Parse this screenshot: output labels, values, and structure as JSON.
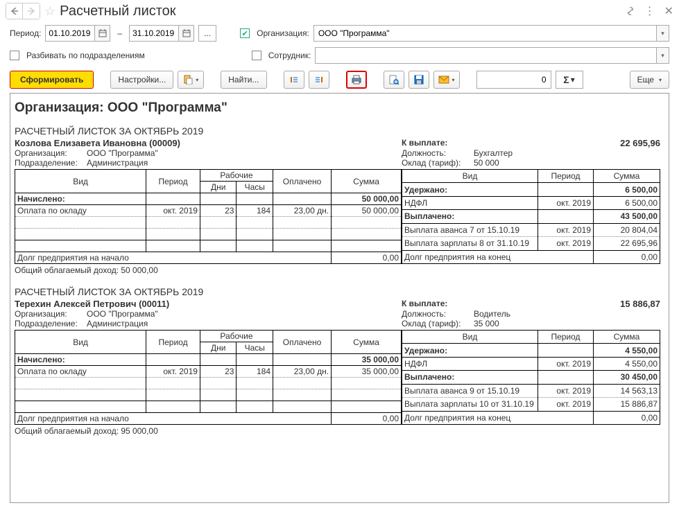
{
  "title": "Расчетный листок",
  "period": {
    "label": "Период:",
    "from": "01.10.2019",
    "to": "31.10.2019",
    "dash": "–"
  },
  "org_filter": {
    "checked": true,
    "label": "Организация:",
    "value": "ООО \"Программа\""
  },
  "split_depts": {
    "checked": false,
    "label": "Разбивать по подразделениям"
  },
  "employee_filter": {
    "checked": false,
    "label": "Сотрудник:",
    "value": ""
  },
  "toolbar": {
    "form": "Сформировать",
    "settings": "Настройки...",
    "find": "Найти...",
    "num_value": "0",
    "more": "Еще"
  },
  "report": {
    "org_header": "Организация: ООО \"Программа\"",
    "headers": {
      "vid": "Вид",
      "period": "Период",
      "work": "Рабочие",
      "days": "Дни",
      "hours": "Часы",
      "paid": "Оплачено",
      "sum": "Сумма",
      "accrued": "Начислено:",
      "withheld": "Удержано:",
      "paid_out": "Выплачено:",
      "debt_start": "Долг предприятия на начало",
      "debt_end": "Долг предприятия на конец",
      "tax_income": "Общий облагаемый доход:"
    },
    "slips": [
      {
        "title": "РАСЧЕТНЫЙ ЛИСТОК ЗА ОКТЯБРЬ 2019",
        "name": "Козлова Елизавета Ивановна (00009)",
        "to_pay_label": "К выплате:",
        "to_pay": "22 695,96",
        "org_label": "Организация:",
        "org": "ООО \"Программа\"",
        "pos_label": "Должность:",
        "pos": "Бухгалтер",
        "dept_label": "Подразделение:",
        "dept": "Администрация",
        "salary_label": "Оклад (тариф):",
        "salary": "50 000",
        "accrued_total": "50 000,00",
        "withheld_total": "6 500,00",
        "paidout_total": "43 500,00",
        "accrued_rows": [
          {
            "vid": "Оплата по окладу",
            "period": "окт. 2019",
            "days": "23",
            "hours": "184",
            "paid": "23,00 дн.",
            "sum": "50 000,00"
          }
        ],
        "withheld_rows": [
          {
            "vid": "НДФЛ",
            "period": "окт. 2019",
            "sum": "6 500,00"
          }
        ],
        "payout_rows": [
          {
            "vid": "Выплата аванса 7 от 15.10.19",
            "period": "окт. 2019",
            "sum": "20 804,04"
          },
          {
            "vid": "Выплата зарплаты 8 от 31.10.19",
            "period": "окт. 2019",
            "sum": "22 695,96"
          }
        ],
        "debt_start": "0,00",
        "debt_end": "0,00",
        "tax_income": "50 000,00"
      },
      {
        "title": "РАСЧЕТНЫЙ ЛИСТОК ЗА ОКТЯБРЬ 2019",
        "name": "Терехин Алексей Петрович (00011)",
        "to_pay_label": "К выплате:",
        "to_pay": "15 886,87",
        "org_label": "Организация:",
        "org": "ООО \"Программа\"",
        "pos_label": "Должность:",
        "pos": "Водитель",
        "dept_label": "Подразделение:",
        "dept": "Администрация",
        "salary_label": "Оклад (тариф):",
        "salary": "35 000",
        "accrued_total": "35 000,00",
        "withheld_total": "4 550,00",
        "paidout_total": "30 450,00",
        "accrued_rows": [
          {
            "vid": "Оплата по окладу",
            "period": "окт. 2019",
            "days": "23",
            "hours": "184",
            "paid": "23,00 дн.",
            "sum": "35 000,00"
          }
        ],
        "withheld_rows": [
          {
            "vid": "НДФЛ",
            "period": "окт. 2019",
            "sum": "4 550,00"
          }
        ],
        "payout_rows": [
          {
            "vid": "Выплата аванса 9 от 15.10.19",
            "period": "окт. 2019",
            "sum": "14 563,13"
          },
          {
            "vid": "Выплата зарплаты 10 от 31.10.19",
            "period": "окт. 2019",
            "sum": "15 886,87"
          }
        ],
        "debt_start": "0,00",
        "debt_end": "0,00",
        "tax_income": "95 000,00"
      }
    ]
  }
}
